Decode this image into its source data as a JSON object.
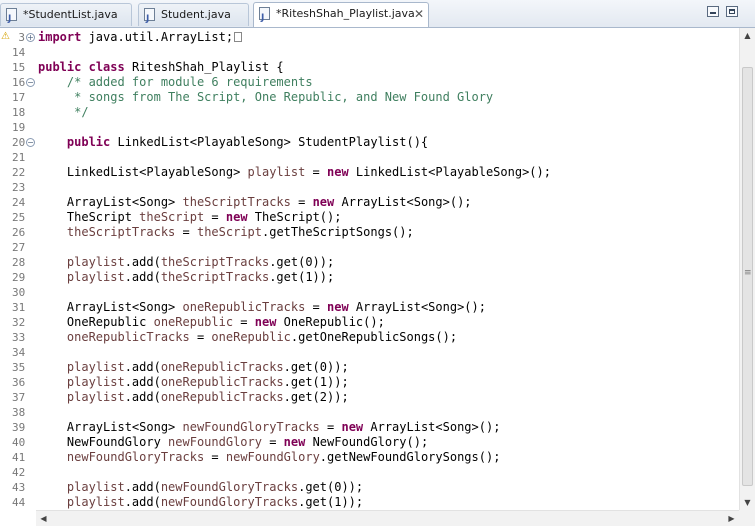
{
  "tabs": [
    {
      "label": "*StudentList.java",
      "active": false,
      "icon": "java-file-icon"
    },
    {
      "label": "Student.java",
      "active": false,
      "icon": "java-file-icon"
    },
    {
      "label": "*RiteshShah_Playlist.java",
      "active": true,
      "icon": "java-file-icon"
    }
  ],
  "window_controls": [
    "minimize-icon",
    "maximize-icon"
  ],
  "colors": {
    "keyword": "#7f0055",
    "comment": "#3f7f5f",
    "field": "#6a3e3e",
    "line_number": "#787878"
  },
  "editor": {
    "lines": [
      {
        "n": "3",
        "fold": "+",
        "parts": [
          [
            "kw",
            "import"
          ],
          [
            "t",
            " java.util.ArrayList;"
          ]
        ],
        "marker": true,
        "warn": true
      },
      {
        "n": "14",
        "parts": []
      },
      {
        "n": "15",
        "parts": [
          [
            "kw",
            "public"
          ],
          [
            "t",
            " "
          ],
          [
            "kw",
            "class"
          ],
          [
            "t",
            " RiteshShah_Playlist {"
          ]
        ]
      },
      {
        "n": "16",
        "fold": "-",
        "parts": [
          [
            "t",
            "    "
          ],
          [
            "cm",
            "/* added for module 6 requirements"
          ]
        ]
      },
      {
        "n": "17",
        "parts": [
          [
            "cm",
            "     * songs from The Script, One Republic, and New Found Glory"
          ]
        ]
      },
      {
        "n": "18",
        "parts": [
          [
            "cm",
            "     */"
          ]
        ]
      },
      {
        "n": "19",
        "parts": []
      },
      {
        "n": "20",
        "fold": "-",
        "parts": [
          [
            "t",
            "    "
          ],
          [
            "kw",
            "public"
          ],
          [
            "t",
            " LinkedList<PlayableSong> StudentPlaylist(){"
          ]
        ]
      },
      {
        "n": "21",
        "parts": []
      },
      {
        "n": "22",
        "parts": [
          [
            "t",
            "    LinkedList<PlayableSong> "
          ],
          [
            "fld",
            "playlist"
          ],
          [
            "t",
            " = "
          ],
          [
            "kw",
            "new"
          ],
          [
            "t",
            " LinkedList<PlayableSong>();"
          ]
        ]
      },
      {
        "n": "23",
        "parts": []
      },
      {
        "n": "24",
        "parts": [
          [
            "t",
            "    ArrayList<Song> "
          ],
          [
            "fld",
            "theScriptTracks"
          ],
          [
            "t",
            " = "
          ],
          [
            "kw",
            "new"
          ],
          [
            "t",
            " ArrayList<Song>();"
          ]
        ]
      },
      {
        "n": "25",
        "parts": [
          [
            "t",
            "    TheScript "
          ],
          [
            "fld",
            "theScript"
          ],
          [
            "t",
            " = "
          ],
          [
            "kw",
            "new"
          ],
          [
            "t",
            " TheScript();"
          ]
        ]
      },
      {
        "n": "26",
        "parts": [
          [
            "t",
            "    "
          ],
          [
            "fld",
            "theScriptTracks"
          ],
          [
            "t",
            " = "
          ],
          [
            "fld",
            "theScript"
          ],
          [
            "t",
            ".getTheScriptSongs();"
          ]
        ]
      },
      {
        "n": "27",
        "parts": []
      },
      {
        "n": "28",
        "parts": [
          [
            "t",
            "    "
          ],
          [
            "fld",
            "playlist"
          ],
          [
            "t",
            ".add("
          ],
          [
            "fld",
            "theScriptTracks"
          ],
          [
            "t",
            ".get(0));"
          ]
        ]
      },
      {
        "n": "29",
        "parts": [
          [
            "t",
            "    "
          ],
          [
            "fld",
            "playlist"
          ],
          [
            "t",
            ".add("
          ],
          [
            "fld",
            "theScriptTracks"
          ],
          [
            "t",
            ".get(1));"
          ]
        ]
      },
      {
        "n": "30",
        "parts": []
      },
      {
        "n": "31",
        "parts": [
          [
            "t",
            "    ArrayList<Song> "
          ],
          [
            "fld",
            "oneRepublicTracks"
          ],
          [
            "t",
            " = "
          ],
          [
            "kw",
            "new"
          ],
          [
            "t",
            " ArrayList<Song>();"
          ]
        ]
      },
      {
        "n": "32",
        "parts": [
          [
            "t",
            "    OneRepublic "
          ],
          [
            "fld",
            "oneRepublic"
          ],
          [
            "t",
            " = "
          ],
          [
            "kw",
            "new"
          ],
          [
            "t",
            " OneRepublic();"
          ]
        ]
      },
      {
        "n": "33",
        "parts": [
          [
            "t",
            "    "
          ],
          [
            "fld",
            "oneRepublicTracks"
          ],
          [
            "t",
            " = "
          ],
          [
            "fld",
            "oneRepublic"
          ],
          [
            "t",
            ".getOneRepublicSongs();"
          ]
        ]
      },
      {
        "n": "34",
        "parts": []
      },
      {
        "n": "35",
        "parts": [
          [
            "t",
            "    "
          ],
          [
            "fld",
            "playlist"
          ],
          [
            "t",
            ".add("
          ],
          [
            "fld",
            "oneRepublicTracks"
          ],
          [
            "t",
            ".get(0));"
          ]
        ]
      },
      {
        "n": "36",
        "parts": [
          [
            "t",
            "    "
          ],
          [
            "fld",
            "playlist"
          ],
          [
            "t",
            ".add("
          ],
          [
            "fld",
            "oneRepublicTracks"
          ],
          [
            "t",
            ".get(1));"
          ]
        ]
      },
      {
        "n": "37",
        "parts": [
          [
            "t",
            "    "
          ],
          [
            "fld",
            "playlist"
          ],
          [
            "t",
            ".add("
          ],
          [
            "fld",
            "oneRepublicTracks"
          ],
          [
            "t",
            ".get(2));"
          ]
        ]
      },
      {
        "n": "38",
        "parts": []
      },
      {
        "n": "39",
        "parts": [
          [
            "t",
            "    ArrayList<Song> "
          ],
          [
            "fld",
            "newFoundGloryTracks"
          ],
          [
            "t",
            " = "
          ],
          [
            "kw",
            "new"
          ],
          [
            "t",
            " ArrayList<Song>();"
          ]
        ]
      },
      {
        "n": "40",
        "parts": [
          [
            "t",
            "    NewFoundGlory "
          ],
          [
            "fld",
            "newFoundGlory"
          ],
          [
            "t",
            " = "
          ],
          [
            "kw",
            "new"
          ],
          [
            "t",
            " NewFoundGlory();"
          ]
        ]
      },
      {
        "n": "41",
        "parts": [
          [
            "t",
            "    "
          ],
          [
            "fld",
            "newFoundGloryTracks"
          ],
          [
            "t",
            " = "
          ],
          [
            "fld",
            "newFoundGlory"
          ],
          [
            "t",
            ".getNewFoundGlorySongs();"
          ]
        ]
      },
      {
        "n": "42",
        "parts": []
      },
      {
        "n": "43",
        "parts": [
          [
            "t",
            "    "
          ],
          [
            "fld",
            "playlist"
          ],
          [
            "t",
            ".add("
          ],
          [
            "fld",
            "newFoundGloryTracks"
          ],
          [
            "t",
            ".get(0));"
          ]
        ]
      },
      {
        "n": "44",
        "parts": [
          [
            "t",
            "    "
          ],
          [
            "fld",
            "playlist"
          ],
          [
            "t",
            ".add("
          ],
          [
            "fld",
            "newFoundGloryTracks"
          ],
          [
            "t",
            ".get(1));"
          ]
        ]
      }
    ]
  }
}
